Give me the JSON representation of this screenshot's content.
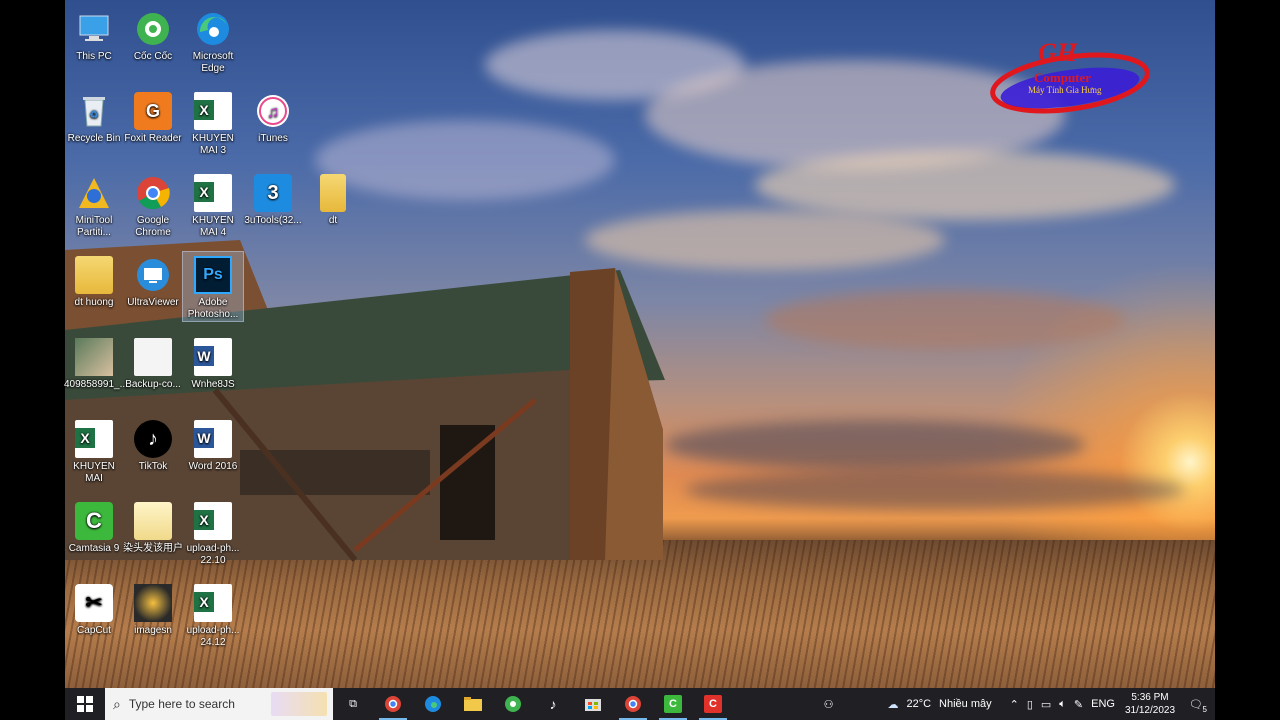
{
  "desktop_icons": [
    {
      "label": "This PC",
      "icon": "this-pc-icon"
    },
    {
      "label": "Cốc Cốc",
      "icon": "coc-coc-icon"
    },
    {
      "label": "Microsoft Edge",
      "icon": "edge-icon"
    },
    {
      "label": "Recycle Bin",
      "icon": "recycle-bin-icon"
    },
    {
      "label": "Foxit Reader",
      "icon": "foxit-icon"
    },
    {
      "label": "KHUYEN MAI 3",
      "icon": "excel-icon"
    },
    {
      "label": "iTunes",
      "icon": "itunes-icon"
    },
    {
      "label": "MiniTool Partiti...",
      "icon": "minitool-icon"
    },
    {
      "label": "Google Chrome",
      "icon": "chrome-icon"
    },
    {
      "label": "KHUYEN MAI 4",
      "icon": "excel-icon"
    },
    {
      "label": "3uTools(32...",
      "icon": "3utools-icon"
    },
    {
      "label": "dt",
      "icon": "folder-icon"
    },
    {
      "label": "dt huong",
      "icon": "folder-icon"
    },
    {
      "label": "UltraViewer",
      "icon": "ultraviewer-icon"
    },
    {
      "label": "Adobe Photosho...",
      "icon": "photoshop-icon"
    },
    {
      "label": "409858991_...",
      "icon": "image-thumb-icon"
    },
    {
      "label": "Backup-co...",
      "icon": "document-icon"
    },
    {
      "label": "Wnhe8JS",
      "icon": "word-icon"
    },
    {
      "label": "KHUYEN MAI",
      "icon": "excel-icon"
    },
    {
      "label": "TikTok",
      "icon": "tiktok-icon"
    },
    {
      "label": "Word 2016",
      "icon": "word-icon"
    },
    {
      "label": "Camtasia 9",
      "icon": "camtasia-icon"
    },
    {
      "label": "染头发该用户",
      "icon": "folder-icon"
    },
    {
      "label": "upload-ph... 22.10",
      "icon": "excel-icon"
    },
    {
      "label": "CapCut",
      "icon": "capcut-icon"
    },
    {
      "label": "imagesn",
      "icon": "image-thumb-icon"
    },
    {
      "label": "upload-ph... 24.12",
      "icon": "excel-icon"
    }
  ],
  "watermark": {
    "brand": "GH",
    "line1": "Computer",
    "line2": "Máy Tính Gia Hưng"
  },
  "taskbar": {
    "search_placeholder": "Type here to search",
    "weather_temp": "22°C",
    "weather_desc": "Nhiều mây",
    "language": "ENG",
    "time": "5:36 PM",
    "date": "31/12/2023",
    "notification_count": "5"
  }
}
